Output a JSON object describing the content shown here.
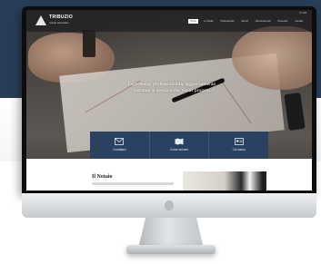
{
  "site": {
    "brand_name": "TRIBUZIO",
    "brand_subtitle": "notaio associato",
    "language": "IT / EN",
    "nav": [
      {
        "label": "Home",
        "active": true
      },
      {
        "label": "Lo Studio",
        "active": false
      },
      {
        "label": "Professionisti",
        "active": false
      },
      {
        "label": "Servizi",
        "active": false
      },
      {
        "label": "Documenti utili",
        "active": false
      },
      {
        "label": "Preventivi",
        "active": false
      },
      {
        "label": "Contatti",
        "active": false
      }
    ],
    "hero": {
      "line1": "Esperienza, professionalità, aggiornamento",
      "line2": "costante al servizio dei Vostri progetti"
    },
    "features": [
      {
        "label": "Contattaci",
        "icon": "envelope-icon"
      },
      {
        "label": "Come arrivare",
        "icon": "map-icon"
      },
      {
        "label": "Chi siamo",
        "icon": "id-card-icon"
      }
    ],
    "section": {
      "title": "Il Notaio"
    }
  },
  "colors": {
    "background_band": "#283e58",
    "feature_box": "#2a4160",
    "bezel": "#0d0d0e"
  }
}
